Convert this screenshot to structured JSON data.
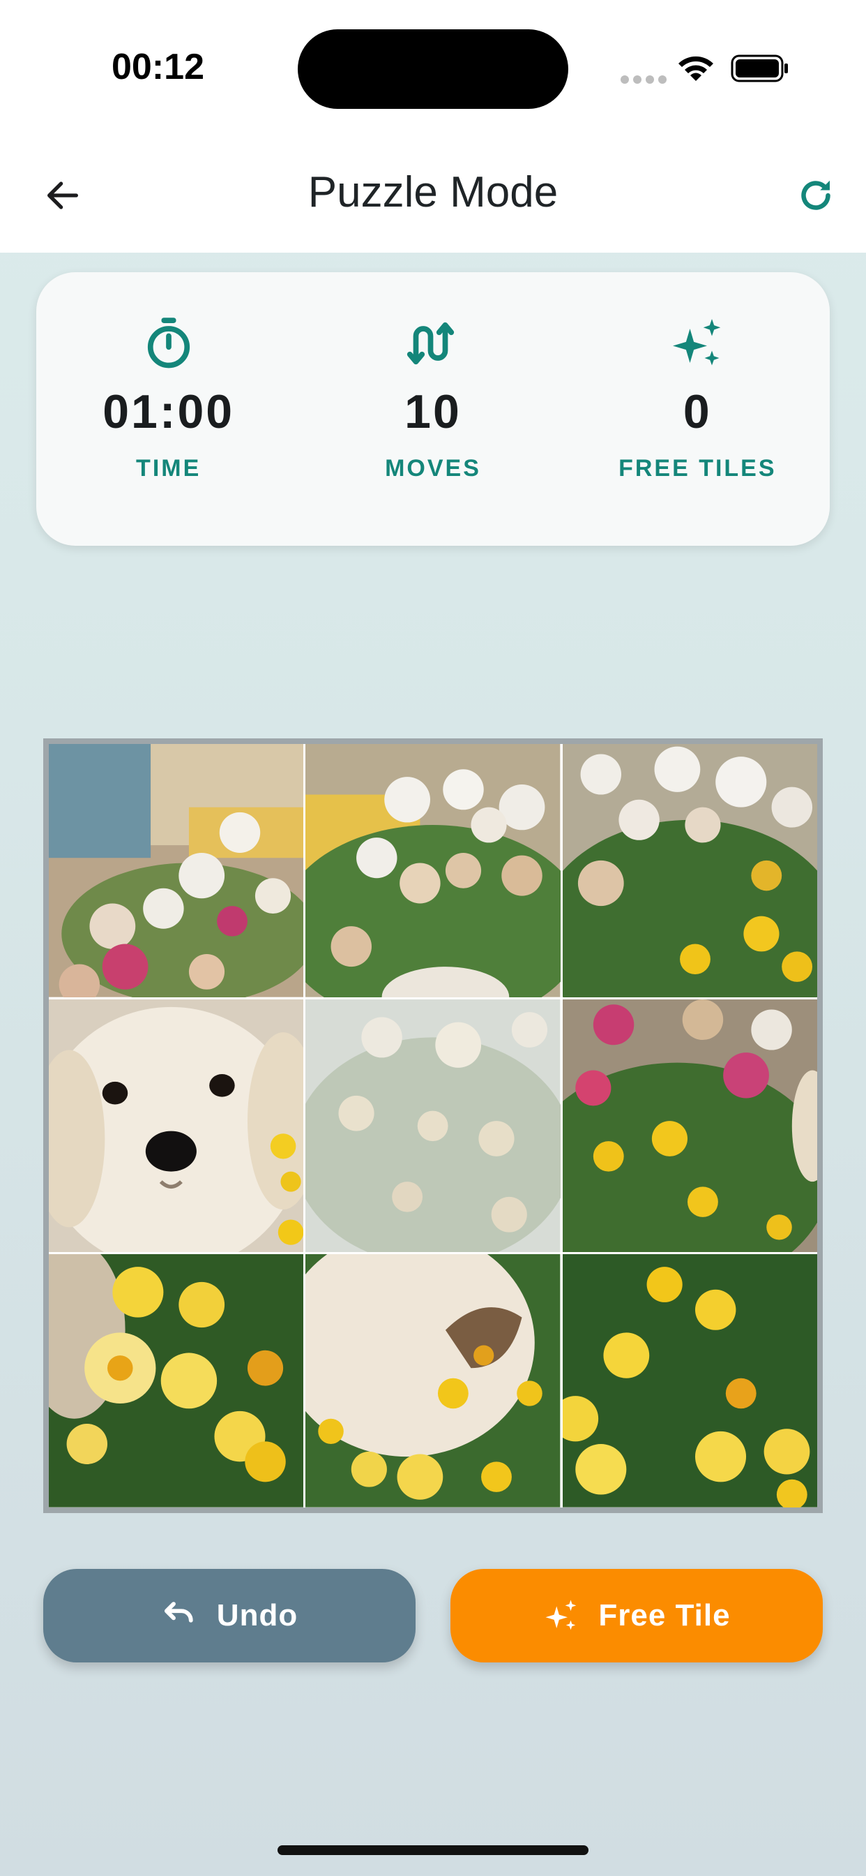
{
  "status_bar": {
    "time": "00:12",
    "icons": [
      "signal-icon",
      "wifi-icon",
      "battery-icon"
    ]
  },
  "nav": {
    "title": "Puzzle Mode",
    "back_icon": "arrow-left-icon",
    "refresh_icon": "refresh-icon"
  },
  "stats": {
    "time": {
      "value": "01:00",
      "label": "TIME",
      "icon": "stopwatch-icon"
    },
    "moves": {
      "value": "10",
      "label": "MOVES",
      "icon": "swap-arrows-icon"
    },
    "free_tiles": {
      "value": "0",
      "label": "FREE TILES",
      "icon": "sparkles-icon"
    }
  },
  "puzzle": {
    "rows": 3,
    "cols": 3,
    "empty_tile_index": 4,
    "tiles": [
      "flowers-pink-blur",
      "flowers-white-top",
      "flowers-white-yellow",
      "puppy-face",
      "empty-faded",
      "flowers-pink-yellow",
      "daisies-yellow-left",
      "puppy-body-daisies",
      "daisies-yellow-right"
    ]
  },
  "buttons": {
    "undo": {
      "label": "Undo",
      "icon": "undo-icon"
    },
    "free_tile": {
      "label": "Free Tile",
      "icon": "sparkles-icon"
    }
  },
  "colors": {
    "accent_teal": "#14867a",
    "undo_bg": "#5f7d8e",
    "free_tile_bg": "#fb8c00"
  }
}
